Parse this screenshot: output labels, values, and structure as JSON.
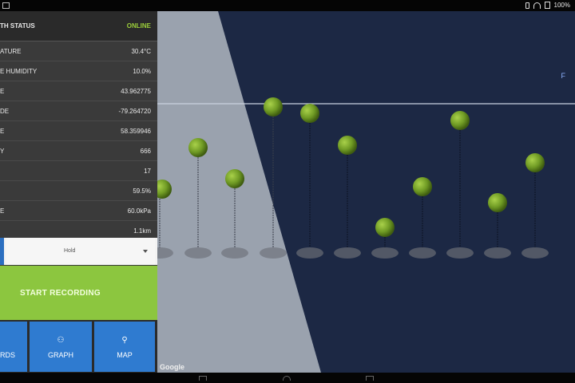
{
  "status_bar": {
    "battery": "100%"
  },
  "readings": {
    "status": {
      "label": "TH STATUS",
      "value": "ONLINE"
    },
    "rows": [
      {
        "label": "ATURE",
        "value": "30.4°C"
      },
      {
        "label": "E HUMIDITY",
        "value": "10.0%"
      },
      {
        "label": "E",
        "value": "43.962775"
      },
      {
        "label": "DE",
        "value": "-79.264720"
      },
      {
        "label": "E",
        "value": "58.359946"
      },
      {
        "label": "Y",
        "value": "666"
      },
      {
        "label": "",
        "value": "17"
      },
      {
        "label": "",
        "value": "59.5%"
      },
      {
        "label": "E",
        "value": "60.0kPa"
      },
      {
        "label": "",
        "value": "1.1km"
      }
    ]
  },
  "selector": {
    "value": "Hold"
  },
  "record_button": {
    "label": "START RECORDING"
  },
  "nav": {
    "records": {
      "label": "RDS"
    },
    "graph": {
      "label": "GRAPH"
    },
    "map": {
      "label": "MAP"
    }
  },
  "map": {
    "attribution": "Google",
    "right_mark": "F"
  },
  "icons": {
    "wifi": "wifi-icon",
    "battery": "battery-icon",
    "vibrate": "vibrate-icon",
    "graph": "graph-icon",
    "map_pin": "map-pin-icon"
  },
  "colors": {
    "panel": "#3a3a3a",
    "status_online": "#9ccf3a",
    "record": "#8cc63f",
    "nav_button": "#2f7bd0",
    "map_dark": "#1c2844",
    "map_light": "#9aa2ae",
    "marker": "#7aa12b"
  }
}
